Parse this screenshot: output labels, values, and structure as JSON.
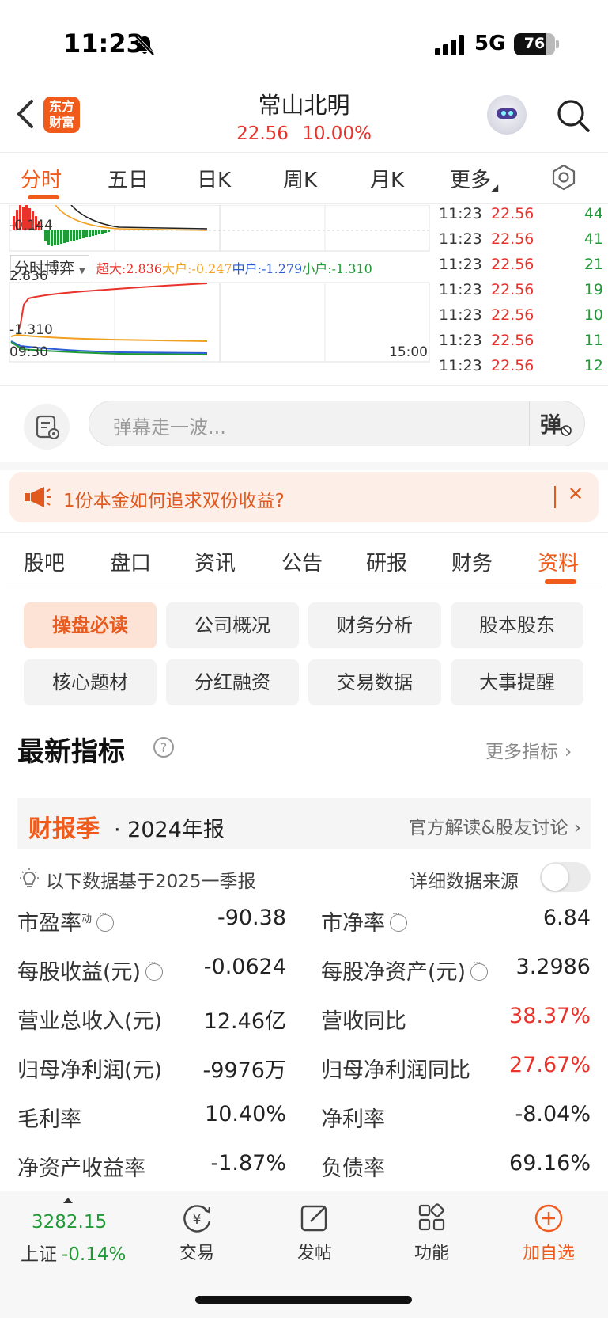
{
  "status_bar": {
    "time": "11:23",
    "network": "5G",
    "battery": "76",
    "battery_level": 0.76
  },
  "header": {
    "back_icon": "chevron-left-icon",
    "logo_line1": "东方",
    "logo_line2": "财富",
    "stock_name": "常山北明",
    "price": "22.56",
    "change_pct": "10.00%"
  },
  "period_tabs": [
    "分时",
    "五日",
    "日K",
    "周K",
    "月K",
    "更多"
  ],
  "chart": {
    "upper_axis_label": "-0.144",
    "panel_selector": "分时博弈",
    "legend": {
      "chaoda": "超大:2.836",
      "dahu": "大户:-0.247",
      "zhonghu": "中户:-1.279",
      "xiaohu": "小户:-1.310"
    },
    "lower_axis_top": "2.836",
    "lower_axis_bottom": "-1.310",
    "time_start": "09:30",
    "time_end": "15:00"
  },
  "trades": [
    {
      "time": "11:23",
      "price": "22.56",
      "vol": "44"
    },
    {
      "time": "11:23",
      "price": "22.56",
      "vol": "41"
    },
    {
      "time": "11:23",
      "price": "22.56",
      "vol": "21"
    },
    {
      "time": "11:23",
      "price": "22.56",
      "vol": "19"
    },
    {
      "time": "11:23",
      "price": "22.56",
      "vol": "10"
    },
    {
      "time": "11:23",
      "price": "22.56",
      "vol": "11"
    },
    {
      "time": "11:23",
      "price": "22.56",
      "vol": "12"
    }
  ],
  "comment": {
    "placeholder": "弹幕走一波...",
    "toggle_label": "弹"
  },
  "promo": {
    "text": "1份本金如何追求双份收益?",
    "close": "✕"
  },
  "section_tabs": [
    "股吧",
    "盘口",
    "资讯",
    "公告",
    "研报",
    "财务",
    "资料"
  ],
  "chips": [
    "操盘必读",
    "公司概况",
    "财务分析",
    "股本股东",
    "核心题材",
    "分红融资",
    "交易数据",
    "大事提醒"
  ],
  "indicators": {
    "title": "最新指标",
    "more_link": "更多指标",
    "report_badge": "财报季",
    "report_period": "· 2024年报",
    "report_link": "官方解读&股友讨论",
    "basis_text": "以下数据基于2025一季报",
    "source_label": "详细数据来源",
    "dynamic_mark": "动",
    "metrics": [
      {
        "label": "市盈率",
        "value": "-90.38"
      },
      {
        "label": "市净率",
        "value": "6.84"
      },
      {
        "label": "每股收益(元)",
        "value": "-0.0624"
      },
      {
        "label": "每股净资产(元)",
        "value": "3.2986"
      },
      {
        "label": "营业总收入(元)",
        "value": "12.46亿"
      },
      {
        "label": "营收同比",
        "value": "38.37%"
      },
      {
        "label": "归母净利润(元)",
        "value": "-9976万"
      },
      {
        "label": "归母净利润同比",
        "value": "27.67%"
      },
      {
        "label": "毛利率",
        "value": "10.40%"
      },
      {
        "label": "净利率",
        "value": "-8.04%"
      },
      {
        "label": "净资产收益率",
        "value": "-1.87%"
      },
      {
        "label": "负债率",
        "value": "69.16%"
      }
    ]
  },
  "bottom_nav": {
    "index_value": "3282.15",
    "index_name": "上证",
    "index_change": "-0.14%",
    "items": [
      "交易",
      "发帖",
      "功能",
      "加自选"
    ]
  },
  "colors": {
    "accent": "#f05a1a",
    "up": "#e8322a",
    "down": "#1f9a36",
    "big": "#f2a020",
    "mid": "#2a5cd8"
  }
}
